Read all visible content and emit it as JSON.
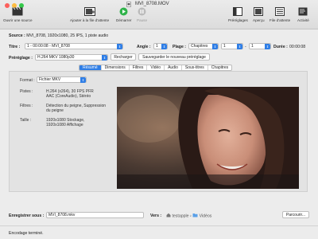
{
  "window": {
    "title": "MVI_8708.MOV"
  },
  "toolbar": {
    "open_source": "Ouvrir une source",
    "add_to_queue": "Ajouter à la file d'attente",
    "start": "Démarrer",
    "pause": "Pause",
    "presets": "Préréglages",
    "preview": "Aperçu",
    "queue": "File d'attente",
    "activity": "Activité"
  },
  "source": {
    "label": "Source :",
    "value": "MVI_8708, 1920x1080, 25 IPS, 1 piste audio"
  },
  "title_row": {
    "title_label": "Titre :",
    "title_value": "1 - 00:00:08 - MVI_8708",
    "angle_label": "Angle :",
    "angle_value": "1",
    "range_label": "Plage :",
    "range_value": "Chapitres",
    "range_start": "1",
    "range_sep": "-",
    "range_end": "1",
    "duration_label": "Durée :",
    "duration_value": "00:00:08"
  },
  "preset_row": {
    "label": "Préréglage :",
    "value": "H.264 MKV 1080p30",
    "reload": "Recharger",
    "save_new": "Sauvegarder le nouveau préréglage"
  },
  "tabs": [
    "Résumé",
    "Dimensions",
    "Filtres",
    "Vidéo",
    "Audio",
    "Sous-titres",
    "Chapitres"
  ],
  "active_tab": "Résumé",
  "summary": {
    "format_label": "Format :",
    "format_value": "Fichier MKV",
    "tracks_label": "Pistes :",
    "tracks_line1": "H.264 (x264), 30 FPS PFR",
    "tracks_line2": "AAC (CoreAudio), Stéréo",
    "filters_label": "Filtres :",
    "filters_line1": "Détection du peigne, Suppression",
    "filters_line2": "du peigne",
    "size_label": "Taille :",
    "size_line1": "1920x1080 Stockage,",
    "size_line2": "1920x1080 Affichage"
  },
  "save_row": {
    "label": "Enregistrer sous :",
    "filename": "MVI_8708.mkv",
    "to_label": "Vers :",
    "path_user": "testapple",
    "path_sep": "›",
    "path_folder": "Vidéos",
    "browse": "Parcourir..."
  },
  "status": {
    "text": "Encodage terminé."
  },
  "colors": {
    "accent": "#2f7ee6",
    "start_green": "#2fb34a"
  }
}
